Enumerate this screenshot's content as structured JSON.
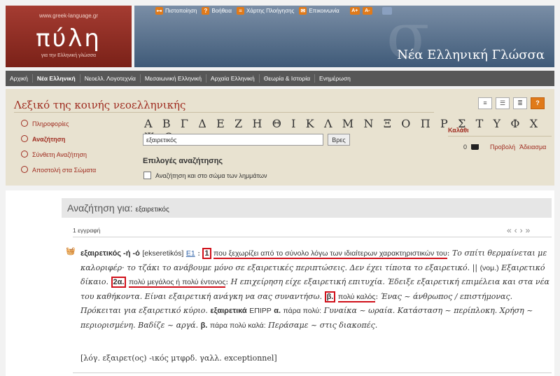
{
  "header": {
    "site_url": "www.greek-language.gr",
    "logo_name": "πύλη",
    "logo_tagline": "για την Ελληνική γλώσσα",
    "section_title": "Νέα Ελληνική Γλώσσα",
    "banner_deco": "σ",
    "toplinks": [
      {
        "label": "Πιστοποίηση",
        "icon": "certificate-icon",
        "glyph": "⊶"
      },
      {
        "label": "Βοήθεια",
        "icon": "help-icon",
        "glyph": "?"
      },
      {
        "label": "Χάρτης Πλοήγησης",
        "icon": "sitemap-icon",
        "glyph": "≡"
      },
      {
        "label": "Επικοινωνία",
        "icon": "mail-icon",
        "glyph": "✉"
      }
    ],
    "font_up": "A+",
    "font_down": "A-"
  },
  "nav": [
    "Αρχική",
    "Νέα Ελληνική",
    "Νεοελλ. Λογοτεχνία",
    "Μεσαιωνική Ελληνική",
    "Αρχαία Ελληνική",
    "Θεωρία & Ιστορία",
    "Ενημέρωση"
  ],
  "panel": {
    "title": "Λεξικό της κοινής νεοελληνικής",
    "sidebar": [
      "Πληροφορίες",
      "Αναζήτηση",
      "Σύνθετη Αναζήτηση",
      "Αποστολή στα Σώματα"
    ],
    "alphabet": "Α Β Γ Δ Ε Ζ Η Θ Ι Κ Λ Μ Ν Ξ Ο Π Ρ Σ Τ Υ Φ Χ Ψ Ω",
    "search_value": "εξαιρετικός",
    "search_button": "Βρες",
    "options_title": "Επιλογές αναζήτησης",
    "option_label": "Αναζήτηση και στο σώμα των λημμάτων",
    "cart": {
      "title": "Καλάθι",
      "count": "0",
      "view": "Προβολή",
      "empty": "Άδειασμα"
    }
  },
  "results": {
    "label": "Αναζήτηση για:",
    "query": "εξαιρετικός",
    "count": "1 εγγραφή",
    "pager": "«‹›»",
    "entry": {
      "headword": "εξαιρετικός -ή -ό",
      "pron": "[ekseretikós]",
      "code": "Ε1",
      "colon": ":",
      "n1": "1",
      "def1": "που ξεχωρίζει από το σύνολο λόγω των ιδιαίτερων χαρακτηριστικών του",
      "ex1": "Το σπίτι θερμαίνεται με καλοριφέρ· το τζάκι το ανάβουμε μόνο σε εξαιρετικές περιπτώσεις. Δεν έχει τίποτα το εξαιρετικό.",
      "sep": "||",
      "nom": "(νομ.)",
      "ex_nom": "Εξαιρετικό δίκαιο.",
      "n2": "2α.",
      "def2": "πολύ μεγάλος ή πολύ έντονος",
      "ex2": "Η επιχείρηση είχε εξαιρετική επιτυχία. Έδειξε εξαιρετική επιμέλεια και στα νέα του καθήκοντα. Είναι εξαιρετική ανάγκη να σας συναντήσω.",
      "n3": "β.",
      "def3": "πολύ καλός",
      "ex3": "Ένας ~ άνθρωπος / επιστήμονας. Πρόκειται για εξαιρετικό κύριο.",
      "adv": "εξαιρετικά",
      "adv_pos": "ΕΠΙΡΡ",
      "adv_a": "α.",
      "adv_def1": "πάρα πολύ:",
      "adv_ex1": "Γυναίκα ~ ωραία. Κατάσταση ~ περίπλοκη. Χρήση ~ περιορισμένη. Βαδίζε ~ αργά.",
      "adv_b": "β.",
      "adv_def2": "πάρα πολύ καλά:",
      "adv_ex2": "Περάσαμε ~ στις διακοπές.",
      "etymology": "[λόγ. εξαιρετ(ος) -ικός μτφρδ. γαλλ. exceptionnel]"
    }
  },
  "colors": {
    "brand_red": "#9e2a1e",
    "highlight": "#d0101a",
    "nav_bg": "#575757",
    "panel_bg": "#e8e2d0"
  }
}
